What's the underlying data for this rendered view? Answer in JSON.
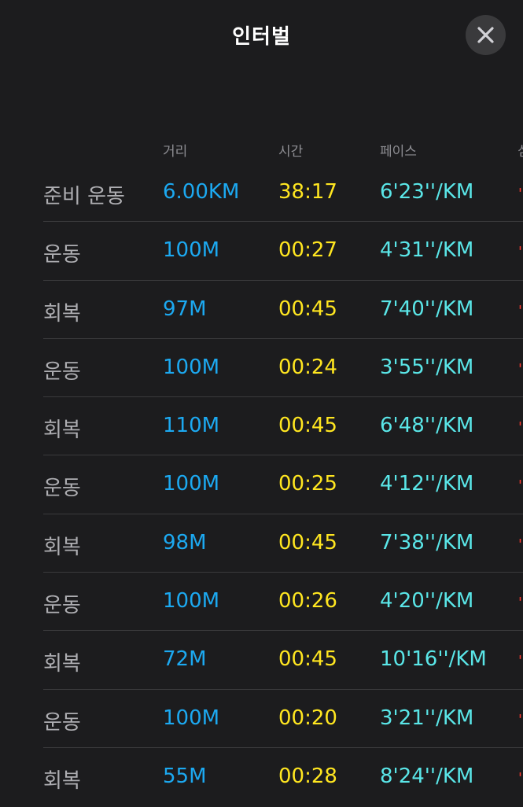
{
  "title": "인터벌",
  "columns": {
    "distance": "거리",
    "time": "시간",
    "pace": "페이스",
    "extra": "심"
  },
  "accent": {
    "distance_color": "#1ca9f1",
    "time_color": "#ffe620",
    "pace_color": "#5ae6e8",
    "extra_color": "#ff3b30"
  },
  "rows": [
    {
      "name": "준비 운동",
      "distance": "6.00KM",
      "time": "38:17",
      "pace": "6'23''/KM",
      "mark": "'"
    },
    {
      "name": "운동",
      "distance": "100M",
      "time": "00:27",
      "pace": "4'31''/KM",
      "mark": "'"
    },
    {
      "name": "회복",
      "distance": "97M",
      "time": "00:45",
      "pace": "7'40''/KM",
      "mark": "'"
    },
    {
      "name": "운동",
      "distance": "100M",
      "time": "00:24",
      "pace": "3'55''/KM",
      "mark": "'"
    },
    {
      "name": "회복",
      "distance": "110M",
      "time": "00:45",
      "pace": "6'48''/KM",
      "mark": "'"
    },
    {
      "name": "운동",
      "distance": "100M",
      "time": "00:25",
      "pace": "4'12''/KM",
      "mark": "'"
    },
    {
      "name": "회복",
      "distance": "98M",
      "time": "00:45",
      "pace": "7'38''/KM",
      "mark": "'"
    },
    {
      "name": "운동",
      "distance": "100M",
      "time": "00:26",
      "pace": "4'20''/KM",
      "mark": "'"
    },
    {
      "name": "회복",
      "distance": "72M",
      "time": "00:45",
      "pace": "10'16''/KM",
      "mark": "'"
    },
    {
      "name": "운동",
      "distance": "100M",
      "time": "00:20",
      "pace": "3'21''/KM",
      "mark": "'"
    },
    {
      "name": "회복",
      "distance": "55M",
      "time": "00:28",
      "pace": "8'24''/KM",
      "mark": "'"
    }
  ]
}
